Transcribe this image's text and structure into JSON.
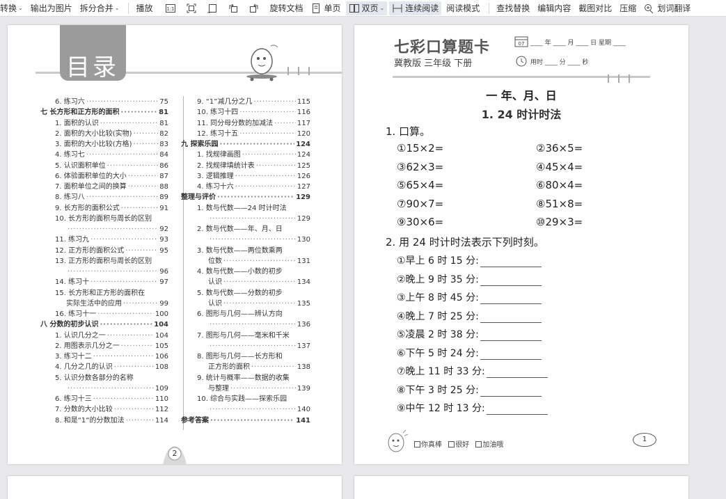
{
  "toolbar": {
    "items": [
      {
        "label": "转换",
        "caret": true
      },
      {
        "label": "输出为图片",
        "caret": false
      },
      {
        "label": "拆分合并",
        "caret": true
      },
      {
        "label": "播放",
        "caret": false
      },
      {
        "label": "旋转文档",
        "caret": false
      },
      {
        "label": "单页",
        "caret": false
      },
      {
        "label": "双页",
        "caret": true
      },
      {
        "label": "连续阅读",
        "caret": false
      },
      {
        "label": "阅读模式",
        "caret": false
      },
      {
        "label": "查找替换",
        "caret": false
      },
      {
        "label": "编辑内容",
        "caret": false
      },
      {
        "label": "截图对比",
        "caret": false
      },
      {
        "label": "压缩",
        "caret": false
      },
      {
        "label": "划词翻译",
        "caret": false
      }
    ],
    "zoom_icon_text": "1:1"
  },
  "left_page": {
    "title": "目录",
    "page_number": "2",
    "col1": [
      {
        "num": "6. 练习六",
        "pg": "75",
        "bold": false,
        "indent": 1
      },
      {
        "num": "七  长方形和正方形的面积",
        "pg": "81",
        "bold": true,
        "indent": 0
      },
      {
        "num": "1. 面积的认识",
        "pg": "81",
        "bold": false,
        "indent": 1
      },
      {
        "num": "2. 面积的大小比较(实物)",
        "pg": "82",
        "bold": false,
        "indent": 1
      },
      {
        "num": "3. 面积的大小比较(方格)",
        "pg": "83",
        "bold": false,
        "indent": 1
      },
      {
        "num": "4. 练习七",
        "pg": "84",
        "bold": false,
        "indent": 1
      },
      {
        "num": "5. 认识面积单位",
        "pg": "86",
        "bold": false,
        "indent": 1
      },
      {
        "num": "6. 体验面积单位的大小",
        "pg": "87",
        "bold": false,
        "indent": 1
      },
      {
        "num": "7. 面积单位之间的换算",
        "pg": "88",
        "bold": false,
        "indent": 1
      },
      {
        "num": "8. 练习八",
        "pg": "89",
        "bold": false,
        "indent": 1
      },
      {
        "num": "9. 长方形的面积公式",
        "pg": "91",
        "bold": false,
        "indent": 1
      },
      {
        "num": "10. 长方形的面积与周长的区别",
        "pg": "",
        "bold": false,
        "indent": 1
      },
      {
        "num": "",
        "pg": "92",
        "bold": false,
        "indent": 2
      },
      {
        "num": "11. 练习九",
        "pg": "93",
        "bold": false,
        "indent": 1
      },
      {
        "num": "12. 正方形的面积公式",
        "pg": "95",
        "bold": false,
        "indent": 1
      },
      {
        "num": "13. 正方形的面积与周长的区别",
        "pg": "",
        "bold": false,
        "indent": 1
      },
      {
        "num": "",
        "pg": "96",
        "bold": false,
        "indent": 2
      },
      {
        "num": "14. 练习十",
        "pg": "97",
        "bold": false,
        "indent": 1
      },
      {
        "num": "15. 长方形和正方形的面积在",
        "pg": "",
        "bold": false,
        "indent": 1
      },
      {
        "num": "实际生活中的应用",
        "pg": "99",
        "bold": false,
        "indent": 2
      },
      {
        "num": "16. 练习十一",
        "pg": "100",
        "bold": false,
        "indent": 1
      },
      {
        "num": "八  分数的初步认识",
        "pg": "104",
        "bold": true,
        "indent": 0
      },
      {
        "num": "1. 认识几分之一",
        "pg": "104",
        "bold": false,
        "indent": 1
      },
      {
        "num": "2. 用图表示几分之一",
        "pg": "105",
        "bold": false,
        "indent": 1
      },
      {
        "num": "3. 练习十二",
        "pg": "106",
        "bold": false,
        "indent": 1
      },
      {
        "num": "4. 几分之几的认识",
        "pg": "108",
        "bold": false,
        "indent": 1
      },
      {
        "num": "5. 认识分数各部分的名称",
        "pg": "",
        "bold": false,
        "indent": 1
      },
      {
        "num": "",
        "pg": "109",
        "bold": false,
        "indent": 2
      },
      {
        "num": "6. 练习十三",
        "pg": "110",
        "bold": false,
        "indent": 1
      },
      {
        "num": "7. 分数的大小比较",
        "pg": "112",
        "bold": false,
        "indent": 1
      },
      {
        "num": "8. 和是“1”的分数加法",
        "pg": "114",
        "bold": false,
        "indent": 1
      }
    ],
    "col2": [
      {
        "num": "9. “1”减几分之几",
        "pg": "115",
        "bold": false,
        "indent": 1
      },
      {
        "num": "10. 练习十四",
        "pg": "116",
        "bold": false,
        "indent": 1
      },
      {
        "num": "11. 同分母分数的加减法",
        "pg": "117",
        "bold": false,
        "indent": 1
      },
      {
        "num": "12. 练习十五",
        "pg": "120",
        "bold": false,
        "indent": 1
      },
      {
        "num": "九  探索乐园",
        "pg": "124",
        "bold": true,
        "indent": 0
      },
      {
        "num": "1. 找规律画图",
        "pg": "124",
        "bold": false,
        "indent": 1
      },
      {
        "num": "2. 找规律填统计表",
        "pg": "125",
        "bold": false,
        "indent": 1
      },
      {
        "num": "3. 逻辑推理",
        "pg": "126",
        "bold": false,
        "indent": 1
      },
      {
        "num": "4. 练习十六",
        "pg": "127",
        "bold": false,
        "indent": 1
      },
      {
        "num": "整理与评价",
        "pg": "129",
        "bold": true,
        "indent": 0
      },
      {
        "num": "1. 数与代数——24 时计时法",
        "pg": "",
        "bold": false,
        "indent": 1
      },
      {
        "num": "",
        "pg": "129",
        "bold": false,
        "indent": 2
      },
      {
        "num": "2. 数与代数——年、月、日",
        "pg": "",
        "bold": false,
        "indent": 1
      },
      {
        "num": "",
        "pg": "130",
        "bold": false,
        "indent": 2
      },
      {
        "num": "3. 数与代数——两位数乘两",
        "pg": "",
        "bold": false,
        "indent": 1
      },
      {
        "num": "位数",
        "pg": "131",
        "bold": false,
        "indent": 2
      },
      {
        "num": "4. 数与代数——小数的初步",
        "pg": "",
        "bold": false,
        "indent": 1
      },
      {
        "num": "认识",
        "pg": "134",
        "bold": false,
        "indent": 2
      },
      {
        "num": "5. 数与代数——分数的初步",
        "pg": "",
        "bold": false,
        "indent": 1
      },
      {
        "num": "认识",
        "pg": "135",
        "bold": false,
        "indent": 2
      },
      {
        "num": "6. 图形与几何——辨认方向",
        "pg": "",
        "bold": false,
        "indent": 1
      },
      {
        "num": "",
        "pg": "136",
        "bold": false,
        "indent": 2
      },
      {
        "num": "7. 图形与几何——毫米和千米",
        "pg": "",
        "bold": false,
        "indent": 1
      },
      {
        "num": "",
        "pg": "137",
        "bold": false,
        "indent": 2
      },
      {
        "num": "8. 图形与几何——长方形和",
        "pg": "",
        "bold": false,
        "indent": 1
      },
      {
        "num": "正方形的面积",
        "pg": "138",
        "bold": false,
        "indent": 2
      },
      {
        "num": "9. 统计与概率——数据的收集",
        "pg": "",
        "bold": false,
        "indent": 1
      },
      {
        "num": "与整理",
        "pg": "139",
        "bold": false,
        "indent": 2
      },
      {
        "num": "10. 综合与实践——探索乐园",
        "pg": "",
        "bold": false,
        "indent": 1
      },
      {
        "num": "",
        "pg": "140",
        "bold": false,
        "indent": 2
      },
      {
        "num": "参考答案",
        "pg": "141",
        "bold": true,
        "indent": 0
      }
    ]
  },
  "right_page": {
    "brand": "七彩口算题卡",
    "sub_brand": "冀教版  三年级  下册",
    "date_line": "____ 年 ____ 月 ____ 日   星期 ____",
    "time_line": "用时 ____ 分 ____ 秒",
    "calendar_day": "07",
    "section_title": "一   年、月、日",
    "section_sub": "1. 24 时计时法",
    "q1_label": "1. 口算。",
    "q1_items": [
      "①15×2=",
      "②36×5=",
      "③62×3=",
      "④45×4=",
      "⑤65×4=",
      "⑥80×4=",
      "⑦90×7=",
      "⑧51×8=",
      "⑨30×6=",
      "⑩29×3="
    ],
    "q2_label": "2. 用 24 时计时法表示下列时刻。",
    "q2_items": [
      "①早上 6 时 15 分:",
      "②晚上 9 时 35 分:",
      "③上午 8 时 45 分:",
      "④晚上 7 时 25 分:",
      "⑤凌晨 2 时 38 分:",
      "⑥下午 5 时 24 分:",
      "⑦晚上 11 时 33 分:",
      "⑧下午 3 时 25 分:",
      "⑨中午 12 时 13 分:"
    ],
    "rating": [
      "你真棒",
      "很好",
      "加油哦"
    ],
    "page_number": "1"
  }
}
